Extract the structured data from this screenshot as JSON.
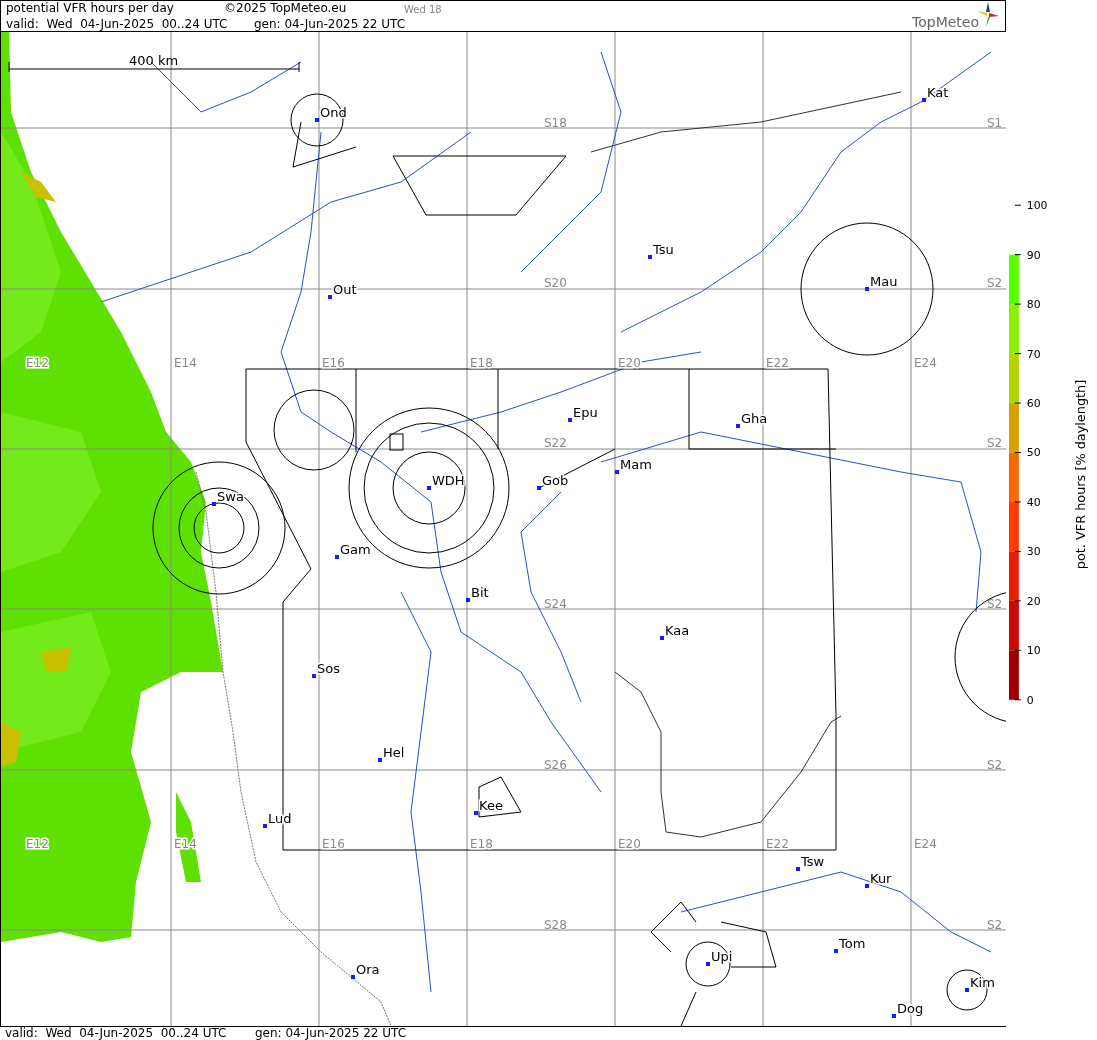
{
  "header": {
    "title": "potential VFR hours per day",
    "copyright": "©2025 TopMeteo.eu",
    "day": "Wed 18",
    "valid": "valid:  Wed  04-Jun-2025  00..24 UTC",
    "generated": "gen: 04-Jun-2025 22 UTC"
  },
  "logo": {
    "text": "TopMeteo"
  },
  "map": {
    "scale": "400 km",
    "longitude_labels": [
      "E12",
      "E14",
      "E16",
      "E18",
      "E20",
      "E22",
      "E24",
      "E12",
      "E14",
      "E16",
      "E18",
      "E20",
      "E22",
      "E24"
    ],
    "latitude_labels": [
      "S18",
      "S20",
      "S22",
      "S24",
      "S26",
      "S28",
      "S1",
      "S2",
      "S2",
      "S2",
      "S2",
      "S2"
    ],
    "airfields": [
      "Ond",
      "Kat",
      "Tsu",
      "Out",
      "Mau",
      "Epu",
      "Gha",
      "Mam",
      "WDH",
      "Gob",
      "Swa",
      "Gam",
      "Bit",
      "Kaa",
      "Sos",
      "Hel",
      "Kee",
      "Lud",
      "Tsw",
      "Kur",
      "Tom",
      "Upi",
      "Ora",
      "Kim",
      "Dog"
    ]
  },
  "colorbar": {
    "title": "pot. VFR hours [% daylength]",
    "ticks": [
      "100",
      "90",
      "80",
      "70",
      "60",
      "50",
      "40",
      "30",
      "20",
      "10",
      "0"
    ],
    "bands": [
      {
        "color": "#5aff00"
      },
      {
        "color": "#88f000"
      },
      {
        "color": "#b4d400"
      },
      {
        "color": "#d8a000"
      },
      {
        "color": "#f26a00"
      },
      {
        "color": "#ff3c00"
      },
      {
        "color": "#e82000"
      },
      {
        "color": "#c80a00"
      },
      {
        "color": "#9a0000"
      }
    ]
  },
  "footer": {
    "valid": "valid:  Wed  04-Jun-2025  00..24 UTC",
    "generated": "gen: 04-Jun-2025 22 UTC"
  }
}
